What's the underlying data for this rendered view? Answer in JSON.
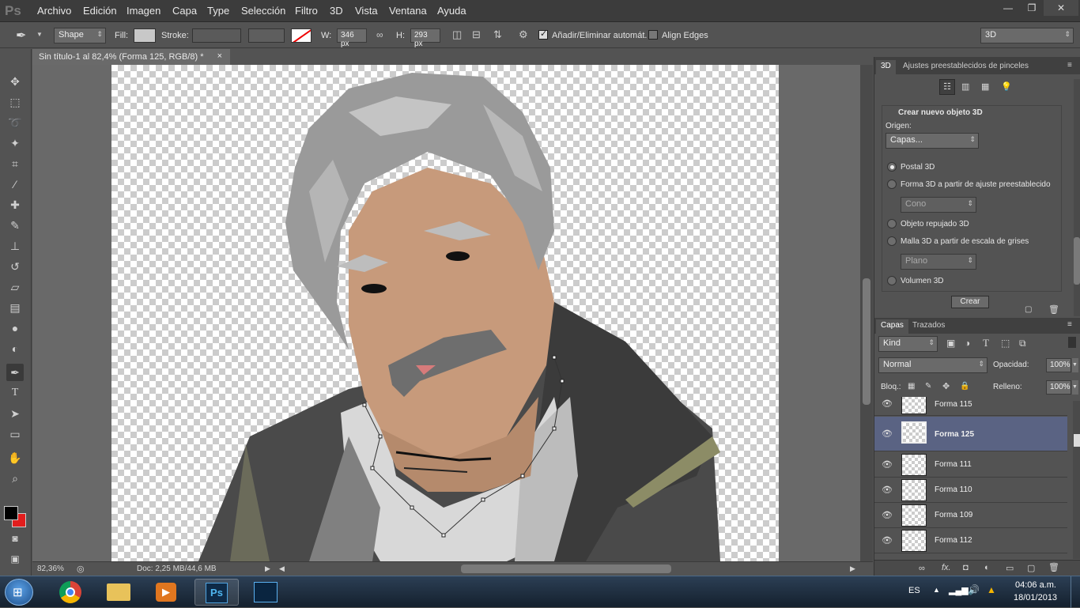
{
  "app": {
    "logo": "Ps"
  },
  "menu": [
    "Archivo",
    "Edición",
    "Imagen",
    "Capa",
    "Type",
    "Selección",
    "Filtro",
    "3D",
    "Vista",
    "Ventana",
    "Ayuda"
  ],
  "window_controls": {
    "minimize": "—",
    "restore": "❐",
    "close": "✕"
  },
  "options": {
    "mode": "Shape",
    "fill_label": "Fill:",
    "stroke_label": "Stroke:",
    "w_label": "W:",
    "w_value": "346 px",
    "h_label": "H:",
    "h_value": "293 px",
    "auto_add": "Añadir/Eliminar automát.",
    "align_edges": "Align Edges",
    "workspace": "3D"
  },
  "document": {
    "tab_title": "Sin título-1 al 82,4% (Forma 125, RGB/8) *",
    "close": "×",
    "zoom": "82,36%",
    "doc_info": "Doc: 2,25 MB/44,6 MB"
  },
  "panel3d": {
    "tabs": [
      "3D",
      "Ajustes preestablecidos de pinceles"
    ],
    "heading": "Crear nuevo objeto 3D",
    "origin_label": "Origen:",
    "origin_value": "Capas...",
    "options": [
      {
        "label": "Postal 3D",
        "selected": true
      },
      {
        "label": "Forma 3D a partir de ajuste preestablecido",
        "selected": false
      },
      {
        "label": "Objeto repujado 3D",
        "selected": false
      },
      {
        "label": "Malla 3D a partir de escala de grises",
        "selected": false
      },
      {
        "label": "Volumen 3D",
        "selected": false
      }
    ],
    "cone_select": "Cono",
    "plane_select": "Plano",
    "create_button": "Crear"
  },
  "layers": {
    "tabs": [
      "Capas",
      "Trazados"
    ],
    "kind": "Kind",
    "blend": "Normal",
    "opacity_label": "Opacidad:",
    "opacity": "100%",
    "lock_label": "Bloq.:",
    "fill_label": "Relleno:",
    "fill": "100%",
    "rows": [
      {
        "name": "Forma 115",
        "selected": false
      },
      {
        "name": "Forma 125",
        "selected": true
      },
      {
        "name": "Forma 111",
        "selected": false
      },
      {
        "name": "Forma 110",
        "selected": false
      },
      {
        "name": "Forma 109",
        "selected": false
      },
      {
        "name": "Forma 112",
        "selected": false
      }
    ]
  },
  "taskbar": {
    "lang": "ES",
    "time": "04:06 a.m.",
    "date": "18/01/2013",
    "ps_label": "Ps"
  },
  "colors": {
    "foreground": "#000000",
    "background": "#e21d1d",
    "selected_layer": "#5a6383"
  }
}
